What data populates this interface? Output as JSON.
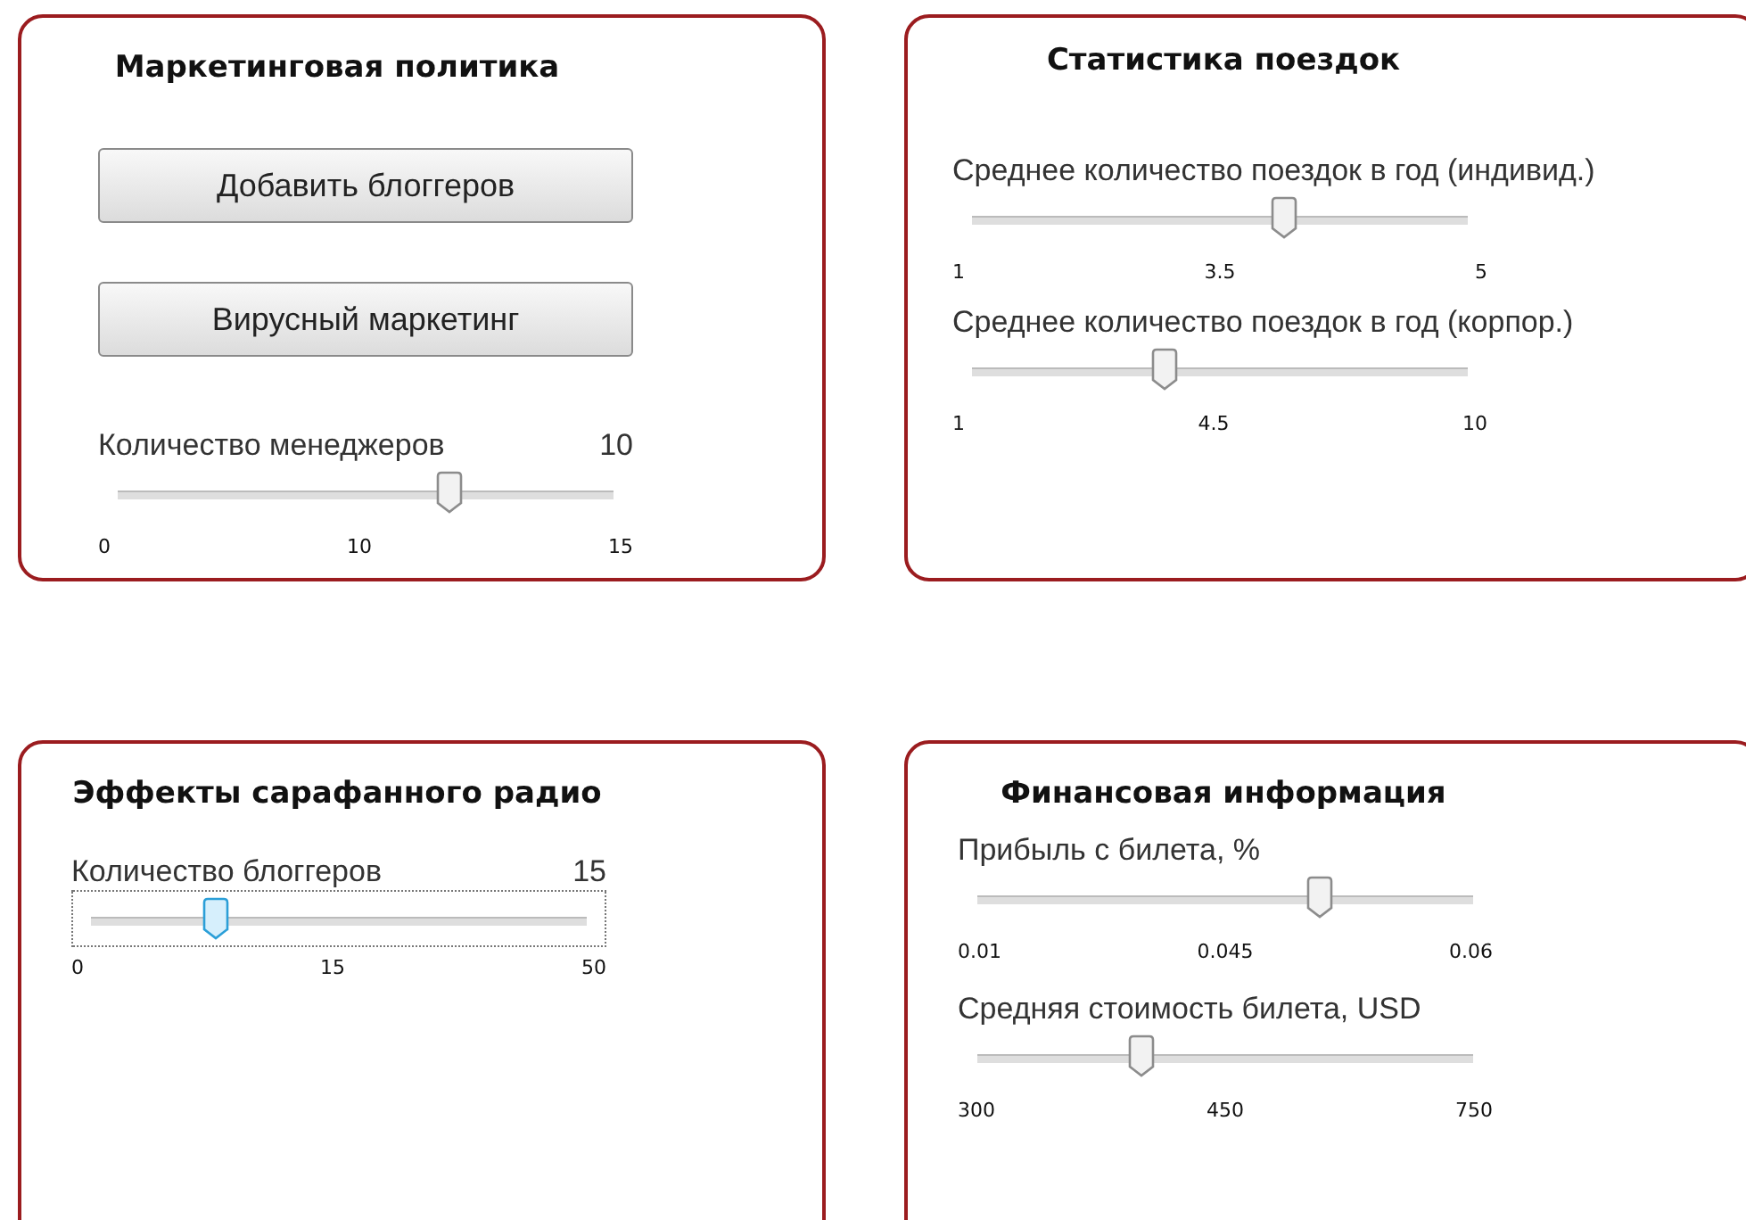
{
  "panels": [
    {
      "title": "Маркетинговая политика",
      "items": [
        {
          "kind": "button",
          "label": "Добавить блоггеров"
        },
        {
          "kind": "button",
          "label": "Вирусный маркетинг"
        },
        {
          "kind": "slider",
          "label": "Количество менеджеров",
          "value": "10",
          "level": 0.67,
          "focused": false,
          "ticks": [
            "0",
            "10",
            "15"
          ]
        }
      ]
    },
    {
      "title": "Статистика поездок",
      "items": [
        {
          "kind": "slider",
          "label": "Среднее количество поездок в год (индивид.)",
          "level": 0.63,
          "focused": false,
          "ticks": [
            "1",
            "3.5",
            "5"
          ]
        },
        {
          "kind": "slider",
          "label": "Среднее количество поездок в год (корпор.)",
          "level": 0.39,
          "focused": false,
          "ticks": [
            "1",
            "4.5",
            "10"
          ]
        }
      ]
    },
    {
      "title": "Эффекты сарафанного радио",
      "items": [
        {
          "kind": "slider",
          "label": "Количество блоггеров",
          "value": "15",
          "level": 0.25,
          "focused": true,
          "ticks": [
            "0",
            "15",
            "50"
          ]
        }
      ]
    },
    {
      "title": "Финансовая информация",
      "items": [
        {
          "kind": "slider",
          "label": "Прибыль с билета, %",
          "level": 0.69,
          "focused": false,
          "ticks": [
            "0.01",
            "0.045",
            "0.06"
          ]
        },
        {
          "kind": "slider",
          "label": "Средняя стоимость билета, USD",
          "level": 0.33,
          "focused": false,
          "ticks": [
            "300",
            "450",
            "750"
          ]
        }
      ]
    }
  ]
}
